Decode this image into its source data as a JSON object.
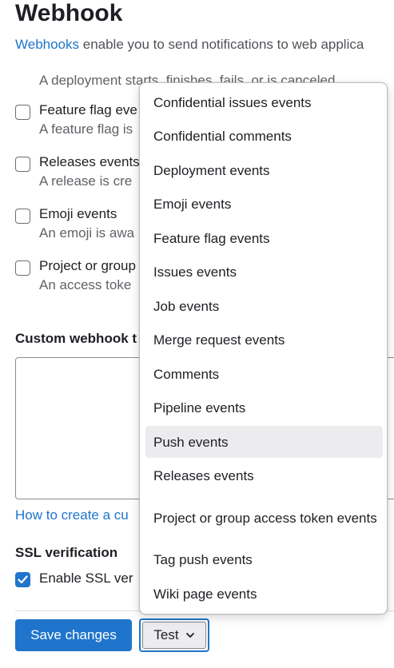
{
  "page": {
    "title": "Webhook",
    "intro_link": "Webhooks",
    "intro_text": " enable you to send notifications to web applica",
    "deployment_help": "A deployment starts, finishes, fails, or is canceled."
  },
  "triggers": [
    {
      "label": "Feature flag eve",
      "help": "A feature flag is",
      "checked": false
    },
    {
      "label": "Releases events",
      "help": "A release is cre",
      "checked": false
    },
    {
      "label": "Emoji events",
      "help": "An emoji is awa",
      "checked": false
    },
    {
      "label": "Project or group",
      "help": "An access toke",
      "checked": false
    }
  ],
  "custom_template": {
    "label": "Custom webhook t",
    "help_link": "How to create a cu"
  },
  "ssl": {
    "label": "SSL verification",
    "checkbox_label": "Enable SSL ver",
    "checked": true
  },
  "actions": {
    "save_label": "Save changes",
    "test_label": "Test"
  },
  "test_dropdown": {
    "items": [
      {
        "label": "Confidential issues events"
      },
      {
        "label": "Confidential comments"
      },
      {
        "label": "Deployment events"
      },
      {
        "label": "Emoji events"
      },
      {
        "label": "Feature flag events"
      },
      {
        "label": "Issues events"
      },
      {
        "label": "Job events"
      },
      {
        "label": "Merge request events"
      },
      {
        "label": "Comments"
      },
      {
        "label": "Pipeline events"
      },
      {
        "label": "Push events",
        "hovered": true
      },
      {
        "label": "Releases events"
      },
      {
        "label": "Project or group access token events"
      },
      {
        "label": "Tag push events"
      },
      {
        "label": "Wiki page events"
      }
    ]
  },
  "colors": {
    "primary": "#1f75cb",
    "text": "#1f1e24",
    "muted": "#626168",
    "hover": "#ececef"
  }
}
